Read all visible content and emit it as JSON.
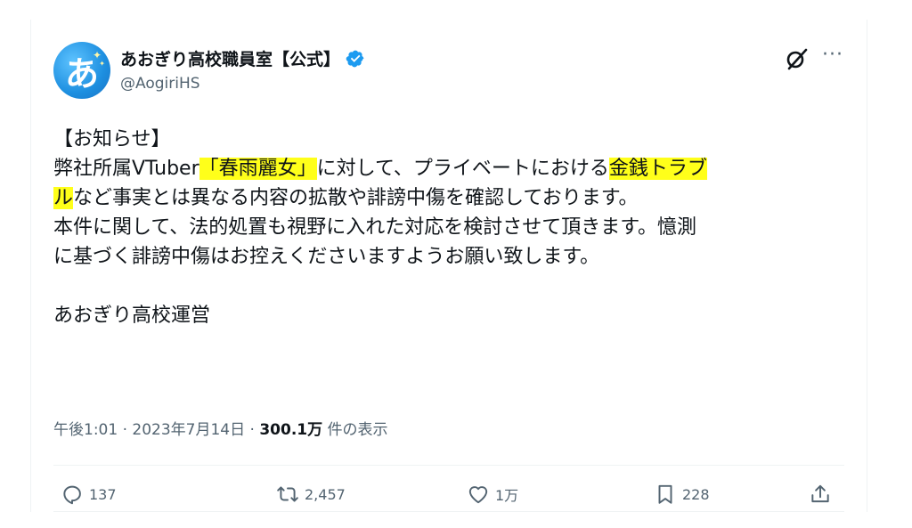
{
  "tweet": {
    "author": {
      "display_name": "あおぎり高校職員室【公式】",
      "handle": "@AogiriHS",
      "avatar_glyph": "あ",
      "verified_icon": "verified-badge-icon"
    },
    "lines": [
      [
        {
          "t": "【お知らせ】"
        }
      ],
      [
        {
          "t": "弊社所属VTuber"
        },
        {
          "t": "「春雨麗女」",
          "hl": true
        },
        {
          "t": "に対して、プライベートにおける"
        },
        {
          "t": "金銭トラブ",
          "hl": true
        }
      ],
      [
        {
          "t": "ル",
          "hl": true
        },
        {
          "t": "など事実とは異なる内容の拡散や誹謗中傷を確認しております。"
        }
      ],
      [
        {
          "t": "本件に関して、法的処置も視野に入れた対応を検討させて頂きます。憶測"
        }
      ],
      [
        {
          "t": "に基づく誹謗中傷はお控えくださいますようお願い致します。"
        }
      ],
      [],
      [
        {
          "t": "あおぎり高校運営"
        }
      ]
    ],
    "meta": {
      "time": "午後1:01",
      "sep1": " · ",
      "date": "2023年7月14日",
      "sep2": " · ",
      "views_count": "300.1万",
      "views_label": " 件の表示"
    },
    "actions": {
      "replies": "137",
      "retweets": "2,457",
      "likes": "1万",
      "bookmarks": "228"
    }
  },
  "colors": {
    "highlight": "#ffff1a",
    "verified": "#1d9bf0",
    "muted": "#536471",
    "text": "#0f1419"
  }
}
